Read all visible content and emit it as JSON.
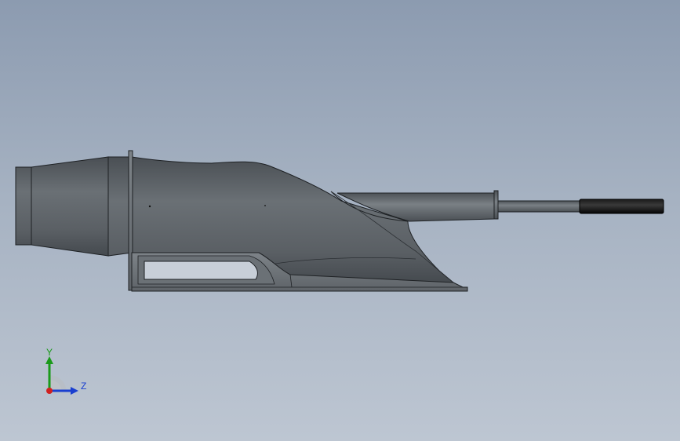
{
  "viewport": {
    "background_top": "#8c9bb0",
    "background_bottom": "#bdc6d2"
  },
  "model": {
    "body_color": "#5c6166",
    "edge_color": "#1e2124",
    "handle_color": "#0d0d0d"
  },
  "triad": {
    "y_label": "Y",
    "z_label": "Z",
    "y_color": "#1a9a1a",
    "z_color": "#1a3fd0",
    "x_color": "#d02020"
  }
}
